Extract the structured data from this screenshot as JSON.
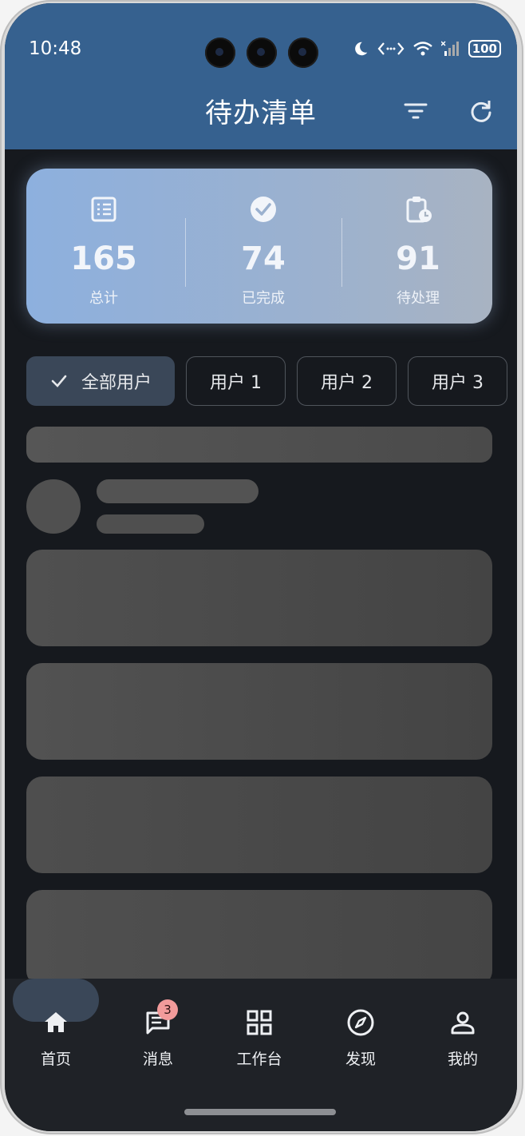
{
  "status": {
    "time": "10:48",
    "battery": "100"
  },
  "header": {
    "title": "待办清单"
  },
  "stats": [
    {
      "icon": "list-icon",
      "value": "165",
      "label": "总计"
    },
    {
      "icon": "check-circle-icon",
      "value": "74",
      "label": "已完成"
    },
    {
      "icon": "pending-clipboard-icon",
      "value": "91",
      "label": "待处理"
    }
  ],
  "filters": [
    {
      "label": "全部用户",
      "selected": true
    },
    {
      "label": "用户 1",
      "selected": false
    },
    {
      "label": "用户 2",
      "selected": false
    },
    {
      "label": "用户 3",
      "selected": false
    }
  ],
  "nav": [
    {
      "label": "首页",
      "icon": "home-icon",
      "active": true
    },
    {
      "label": "消息",
      "icon": "message-icon",
      "badge": "3"
    },
    {
      "label": "工作台",
      "icon": "grid-icon"
    },
    {
      "label": "发现",
      "icon": "compass-icon"
    },
    {
      "label": "我的",
      "icon": "person-icon"
    }
  ],
  "colors": {
    "header": "#36618f",
    "background": "#16191e",
    "chip_selected": "#3a4758"
  }
}
